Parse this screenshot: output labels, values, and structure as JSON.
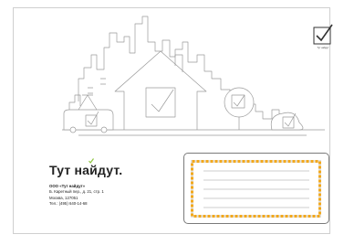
{
  "stamp": {
    "caption": "Тут найдут"
  },
  "brand": {
    "name": "Тут найдут.",
    "accent_color": "#8dc63f"
  },
  "sender": {
    "company": "ООО «Тут найдут»",
    "street": "Б. Каретный пер., д. 21, стр. 1",
    "city": "Москва, 127051",
    "phone": "Тел.: (495) 640-14-68"
  },
  "address_frame": {
    "line_count": 5,
    "dash_colors": [
      "#f3a81b",
      "#e2e2e2"
    ]
  },
  "icons": [
    "stamp-checkmark-icon",
    "house-checkmark-icon",
    "tree-checkmark-icon",
    "bush-checkmark-icon",
    "tram-checkmark-icon"
  ]
}
